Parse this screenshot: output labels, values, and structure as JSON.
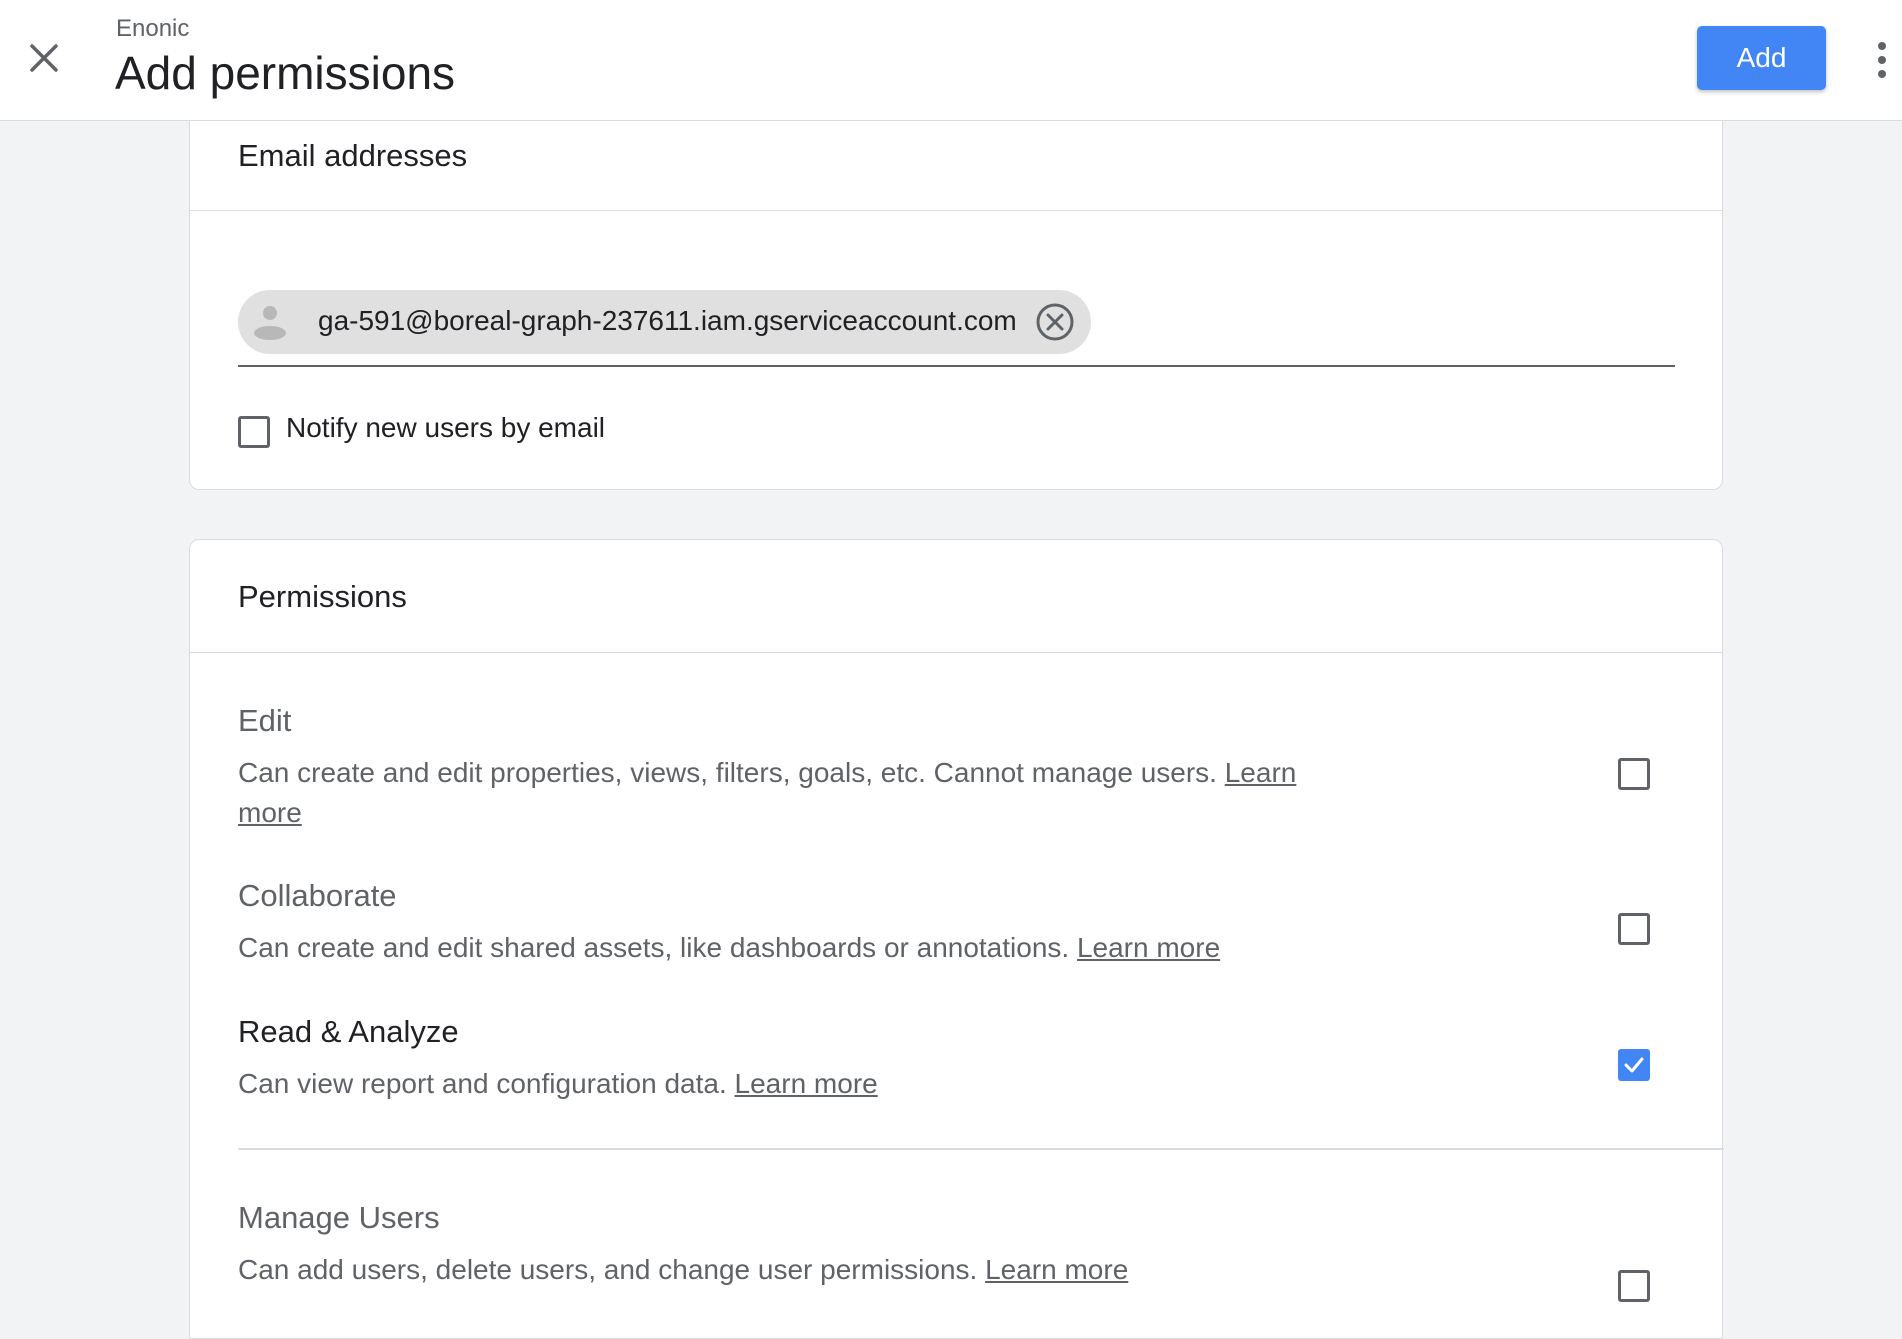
{
  "header": {
    "org": "Enonic",
    "title": "Add permissions",
    "add_label": "Add"
  },
  "email_card": {
    "title": "Email addresses",
    "chip_email": "ga-591@boreal-graph-237611.iam.gserviceaccount.com",
    "notify_label": "Notify new users by email",
    "notify_checked": false
  },
  "permissions_card": {
    "title": "Permissions",
    "items": [
      {
        "title": "Edit",
        "desc": "Can create and edit properties, views, filters, goals, etc. Cannot manage users. ",
        "link": "Learn more",
        "checked": false
      },
      {
        "title": "Collaborate",
        "desc": "Can create and edit shared assets, like dashboards or annotations. ",
        "link": "Learn more",
        "checked": false
      },
      {
        "title": "Read & Analyze",
        "desc": "Can view report and configuration data. ",
        "link": "Learn more",
        "checked": true
      },
      {
        "title": "Manage Users",
        "desc": "Can add users, delete users, and change user permissions. ",
        "link": "Learn more",
        "checked": false
      }
    ]
  },
  "colors": {
    "accent": "#4285f4",
    "background": "#f1f3f4",
    "muted_text": "#5f6368"
  }
}
